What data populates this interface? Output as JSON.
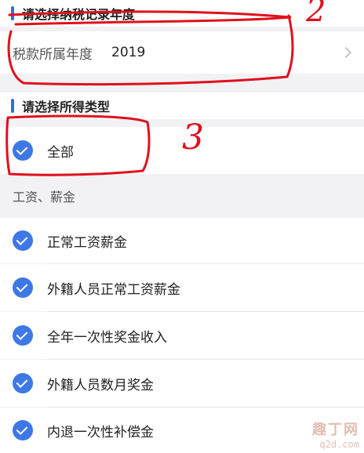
{
  "sections": {
    "year": {
      "title": "请选择纳税记录年度"
    },
    "income_type": {
      "title": "请选择所得类型"
    }
  },
  "year_row": {
    "label": "税款所属年度",
    "value": "2019",
    "icon": "chevron-right-icon"
  },
  "all_option": {
    "label": "全部",
    "checked": true
  },
  "group": {
    "label": "工资、薪金"
  },
  "options": [
    {
      "label": "正常工资薪金",
      "checked": true
    },
    {
      "label": "外籍人员正常工资薪金",
      "checked": true
    },
    {
      "label": "全年一次性奖金收入",
      "checked": true
    },
    {
      "label": "外籍人员数月奖金",
      "checked": true
    },
    {
      "label": "内退一次性补偿金",
      "checked": true
    }
  ],
  "annotations": {
    "mark_2": "2",
    "mark_3": "3",
    "color": "#e0101c"
  },
  "watermark": {
    "line1": "趣丁网",
    "line2": "q2d.com"
  },
  "colors": {
    "accent": "#2f6fe0",
    "check": "#3d78e6",
    "background": "#f2f2f4"
  }
}
